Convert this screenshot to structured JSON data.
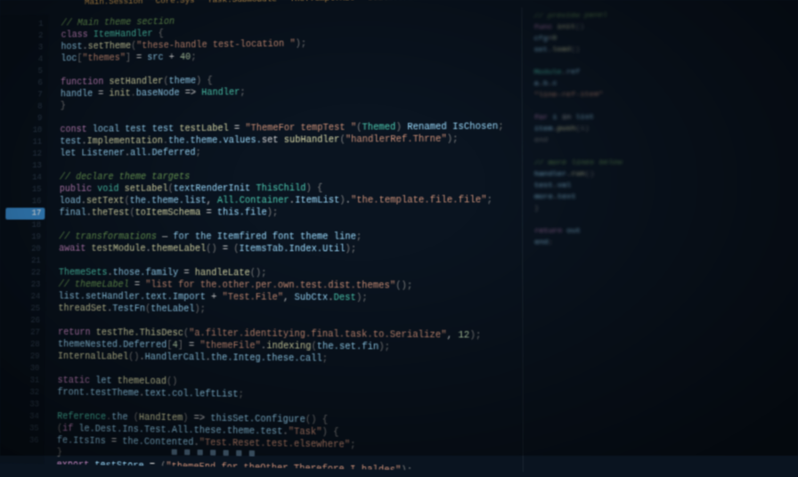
{
  "note": "Photograph of a monitor showing a dark-theme code editor. Text is out of focus and largely illegible; values below are approximations of visible shapes, not verbatim transcription.",
  "tabs": [
    "Main.Session",
    "Core.Sys",
    "Task.Submodule",
    "The.Templ.Kit",
    "Utils.Trace"
  ],
  "lineNumbers": [
    1,
    2,
    3,
    4,
    5,
    6,
    7,
    8,
    9,
    10,
    11,
    12,
    13,
    14,
    15,
    16,
    17,
    18,
    19,
    20,
    21,
    22,
    23,
    24,
    25,
    26,
    27,
    28,
    29,
    30,
    31,
    32,
    33,
    34,
    35,
    36
  ],
  "highlightedLine": 17,
  "code": [
    [
      [
        "com",
        "// Main theme section"
      ]
    ],
    [
      [
        "kw",
        "class "
      ],
      [
        "type",
        "ItemHandler "
      ],
      [
        "pun",
        "{"
      ]
    ],
    [
      [
        "id",
        "  host"
      ],
      [
        "op",
        "."
      ],
      [
        "fn",
        "setTheme"
      ],
      [
        "pun",
        "("
      ],
      [
        "str",
        "\"these-handle test-location \""
      ],
      [
        "pun",
        ");"
      ]
    ],
    [
      [
        "id",
        "  loc"
      ],
      [
        "pun",
        "["
      ],
      [
        "str",
        "\"themes\""
      ],
      [
        "pun",
        "]"
      ],
      [
        "op",
        " = "
      ],
      [
        "id",
        "src"
      ],
      [
        "op",
        " + "
      ],
      [
        "num",
        "40"
      ],
      [
        "pun",
        ";"
      ]
    ],
    [],
    [
      [
        "kw",
        "  function "
      ],
      [
        "fn",
        "setHandler"
      ],
      [
        "pun",
        "("
      ],
      [
        "id",
        "theme"
      ],
      [
        "pun",
        ") {"
      ]
    ],
    [
      [
        "id",
        "    handle "
      ],
      [
        "op",
        "= "
      ],
      [
        "fn",
        "init"
      ],
      [
        "pun",
        "."
      ],
      [
        "id",
        "baseNode "
      ],
      [
        "op",
        "=> "
      ],
      [
        "type",
        "Handler"
      ],
      [
        "pun",
        ";"
      ]
    ],
    [
      [
        "pun",
        "  }"
      ]
    ],
    [],
    [
      [
        "kw",
        "  const "
      ],
      [
        "id",
        "local test test "
      ],
      [
        "fn",
        "testLabel"
      ],
      [
        "op",
        " = "
      ],
      [
        "str",
        "\"ThemeFor tempTest \""
      ],
      [
        "pun",
        "("
      ],
      [
        "type",
        "Themed"
      ],
      [
        "pun",
        ")"
      ],
      [
        "id",
        " Renamed IsChosen"
      ],
      [
        "pun",
        ";"
      ]
    ],
    [
      [
        "id",
        "  test"
      ],
      [
        "op",
        "."
      ],
      [
        "fn",
        "Implementation"
      ],
      [
        "pun",
        "."
      ],
      [
        "id",
        "the.theme.values."
      ],
      [
        "op",
        "set "
      ],
      [
        "fn",
        "subHandler"
      ],
      [
        "pun",
        "("
      ],
      [
        "str",
        "\"handlerRef.Thrne\""
      ],
      [
        "pun",
        ");"
      ]
    ],
    [
      [
        "id",
        "  let "
      ],
      [
        "id",
        "Listener"
      ],
      [
        "op",
        "."
      ],
      [
        "id",
        "all.Deferred"
      ],
      [
        "pun",
        ";"
      ]
    ],
    [],
    [
      [
        "com",
        "  // declare theme targets"
      ]
    ],
    [
      [
        "kw",
        "  public "
      ],
      [
        "type",
        "void "
      ],
      [
        "fn",
        "setLabel"
      ],
      [
        "pun",
        "("
      ],
      [
        "id",
        "textRenderInit "
      ],
      [
        "type",
        "ThisChild"
      ],
      [
        "pun",
        ") {"
      ]
    ],
    [
      [
        "id",
        "    load"
      ],
      [
        "op",
        "."
      ],
      [
        "fn",
        "setText"
      ],
      [
        "pun",
        "("
      ],
      [
        "id",
        "the.theme.list"
      ],
      [
        "op",
        ", "
      ],
      [
        "type",
        "All.Container"
      ],
      [
        "op",
        "."
      ],
      [
        "id",
        "ItemList"
      ],
      [
        "pun",
        ")"
      ],
      [
        "op",
        "."
      ],
      [
        "str",
        "\"the.template.file.file\""
      ],
      [
        "pun",
        ";"
      ]
    ],
    [
      [
        "id",
        "    final"
      ],
      [
        "op",
        "."
      ],
      [
        "fn",
        "theTest"
      ],
      [
        "pun",
        "("
      ],
      [
        "fn",
        "toItemSchema"
      ],
      [
        "op",
        " = "
      ],
      [
        "id",
        "this.file"
      ],
      [
        "pun",
        ");"
      ]
    ],
    [],
    [
      [
        "com",
        "  // transformations"
      ],
      [
        "op",
        "  — "
      ],
      [
        "id",
        "for the Itemfired font theme line"
      ],
      [
        "pun",
        ";"
      ]
    ],
    [
      [
        "kw",
        "  await "
      ],
      [
        "fn",
        "testModule"
      ],
      [
        "op",
        "."
      ],
      [
        "fn",
        "themeLabel"
      ],
      [
        "pun",
        "()"
      ],
      [
        "op",
        " = "
      ],
      [
        "pun",
        "("
      ],
      [
        "id",
        "ItemsTab.Index.Util"
      ],
      [
        "pun",
        ");"
      ]
    ],
    [],
    [
      [
        "type",
        "  ThemeSets"
      ],
      [
        "op",
        "."
      ],
      [
        "id",
        "those.family "
      ],
      [
        "op",
        "= "
      ],
      [
        "fn",
        "handleLate"
      ],
      [
        "pun",
        "()"
      ],
      [
        "pun",
        ";"
      ]
    ],
    [
      [
        "com",
        "    // themeLabel"
      ],
      [
        "op",
        " ="
      ],
      [
        "str",
        " \"list for the.other.per.own.test.dist.themes\""
      ],
      [
        "pun",
        "();"
      ]
    ],
    [
      [
        "id",
        "    list.setHandler.text.Import"
      ],
      [
        "op",
        " + "
      ],
      [
        "str",
        "\"Test.File\""
      ],
      [
        "op",
        ", "
      ],
      [
        "id",
        "SubCtx"
      ],
      [
        "op",
        "."
      ],
      [
        "type",
        "Dest"
      ],
      [
        "pun",
        ");"
      ]
    ],
    [
      [
        "fn",
        "    threadSet"
      ],
      [
        "op",
        "."
      ],
      [
        "id",
        "TestFn"
      ],
      [
        "pun",
        "("
      ],
      [
        "id",
        "theLabel"
      ],
      [
        "pun",
        ");"
      ]
    ],
    [],
    [
      [
        "kw",
        "  return "
      ],
      [
        "fn",
        "testThe.ThisDesc"
      ],
      [
        "pun",
        "("
      ],
      [
        "str",
        "\"a.filter.identitying.final.task.to.Serialize\""
      ],
      [
        "op",
        ", "
      ],
      [
        "num",
        "12"
      ],
      [
        "pun",
        ");"
      ]
    ],
    [
      [
        "id",
        "    themeNested.Deferred"
      ],
      [
        "pun",
        "["
      ],
      [
        "num",
        "4"
      ],
      [
        "pun",
        "]"
      ],
      [
        "op",
        " = "
      ],
      [
        "str",
        "\"themeFile\""
      ],
      [
        "op",
        "."
      ],
      [
        "fn",
        "indexing"
      ],
      [
        "pun",
        "("
      ],
      [
        "id",
        "the.set.fin"
      ],
      [
        "pun",
        ");"
      ]
    ],
    [
      [
        "fn",
        "    InternalLabel"
      ],
      [
        "pun",
        "()"
      ],
      [
        "op",
        "."
      ],
      [
        "id",
        "HandlerCall"
      ],
      [
        "op",
        "."
      ],
      [
        "id",
        "the.Integ.these.call"
      ],
      [
        "pun",
        ";"
      ]
    ],
    [],
    [
      [
        "kw",
        "  static "
      ],
      [
        "id",
        "let "
      ],
      [
        "fn",
        "themeLoad"
      ],
      [
        "pun",
        "()"
      ]
    ],
    [
      [
        "id",
        "    front.testTheme"
      ],
      [
        "op",
        "."
      ],
      [
        "id",
        "text.col.leftList"
      ],
      [
        "pun",
        ";"
      ]
    ],
    [],
    [
      [
        "type",
        "  Reference"
      ],
      [
        "pun",
        "."
      ],
      [
        "id",
        "the "
      ],
      [
        "pun",
        "("
      ],
      [
        "fn",
        "HandItem"
      ],
      [
        "pun",
        ")"
      ],
      [
        "op",
        " => "
      ],
      [
        "id",
        "thisSet.Configure"
      ],
      [
        "pun",
        "() {"
      ]
    ],
    [
      [
        "pun",
        "    ("
      ],
      [
        "kw",
        "if "
      ],
      [
        "id",
        "le.Dest.Ins.Test.All.these.theme.test"
      ],
      [
        "op",
        "."
      ],
      [
        "str",
        "\"Task\""
      ],
      [
        "pun",
        ") {"
      ]
    ],
    [
      [
        "id",
        "      fe.ItsIns "
      ],
      [
        "op",
        "= "
      ],
      [
        "id",
        "the.Contented"
      ],
      [
        "op",
        "."
      ],
      [
        "str",
        "\"Test.Reset.test.elsewhere\""
      ],
      [
        "pun",
        ";"
      ]
    ],
    [
      [
        "pun",
        "    }"
      ]
    ],
    [
      [
        "kw",
        "  export "
      ],
      [
        "id",
        "testStore"
      ],
      [
        "op",
        " = "
      ],
      [
        "pun",
        "("
      ],
      [
        "str",
        "\"themeEnd for theOther.Therefore.I.haldes\""
      ],
      [
        "pun",
        ");"
      ]
    ]
  ],
  "rightPane": [
    [
      [
        "com",
        "// preview panel"
      ]
    ],
    [
      [
        "kw",
        "func "
      ],
      [
        "fn",
        "init"
      ],
      [
        "pun",
        "()"
      ]
    ],
    [
      [
        "id",
        "  cfg"
      ],
      [
        "op",
        "="
      ],
      [
        "num",
        "0"
      ]
    ],
    [
      [
        "id",
        "  set"
      ],
      [
        "op",
        "."
      ],
      [
        "fn",
        "load"
      ],
      [
        "pun",
        "()"
      ]
    ],
    [],
    [
      [
        "type",
        "Module"
      ],
      [
        "op",
        "."
      ],
      [
        "id",
        "ref"
      ]
    ],
    [
      [
        "id",
        "  a"
      ],
      [
        "op",
        "."
      ],
      [
        "id",
        "b"
      ],
      [
        "op",
        "."
      ],
      [
        "id",
        "c"
      ]
    ],
    [
      [
        "str",
        "  \"line-ref-item\""
      ]
    ],
    [],
    [
      [
        "kw",
        "for "
      ],
      [
        "id",
        "i"
      ],
      [
        "op",
        " in "
      ],
      [
        "id",
        "list"
      ]
    ],
    [
      [
        "id",
        "  item"
      ],
      [
        "op",
        "."
      ],
      [
        "fn",
        "push"
      ],
      [
        "pun",
        "(i)"
      ]
    ],
    [
      [
        "pun",
        "end"
      ]
    ],
    [],
    [
      [
        "com",
        "// more lines below"
      ]
    ],
    [
      [
        "id",
        "handler"
      ],
      [
        "op",
        "."
      ],
      [
        "fn",
        "run"
      ],
      [
        "pun",
        "()"
      ]
    ],
    [
      [
        "id",
        "  test"
      ],
      [
        "op",
        "."
      ],
      [
        "id",
        "val"
      ]
    ],
    [
      [
        "id",
        "  more"
      ],
      [
        "op",
        "."
      ],
      [
        "id",
        "text"
      ]
    ],
    [
      [
        "pun",
        "}"
      ]
    ],
    [],
    [
      [
        "kw",
        "return "
      ],
      [
        "id",
        "out"
      ]
    ],
    [
      [
        "id",
        "end"
      ],
      [
        "pun",
        ";"
      ]
    ],
    [],
    [],
    [],
    [],
    [],
    [],
    [],
    [],
    [],
    [],
    [],
    [],
    [],
    [],
    []
  ],
  "colors": {
    "background": "#0a1420",
    "keyword": "#c586c0",
    "type": "#4ec9b0",
    "function": "#dcdcaa",
    "string": "#ce9178",
    "identifier": "#9cdcfe",
    "comment": "#6a9955",
    "number": "#b5cea8",
    "tab": "#d4a054",
    "gutter": "#556b80"
  }
}
